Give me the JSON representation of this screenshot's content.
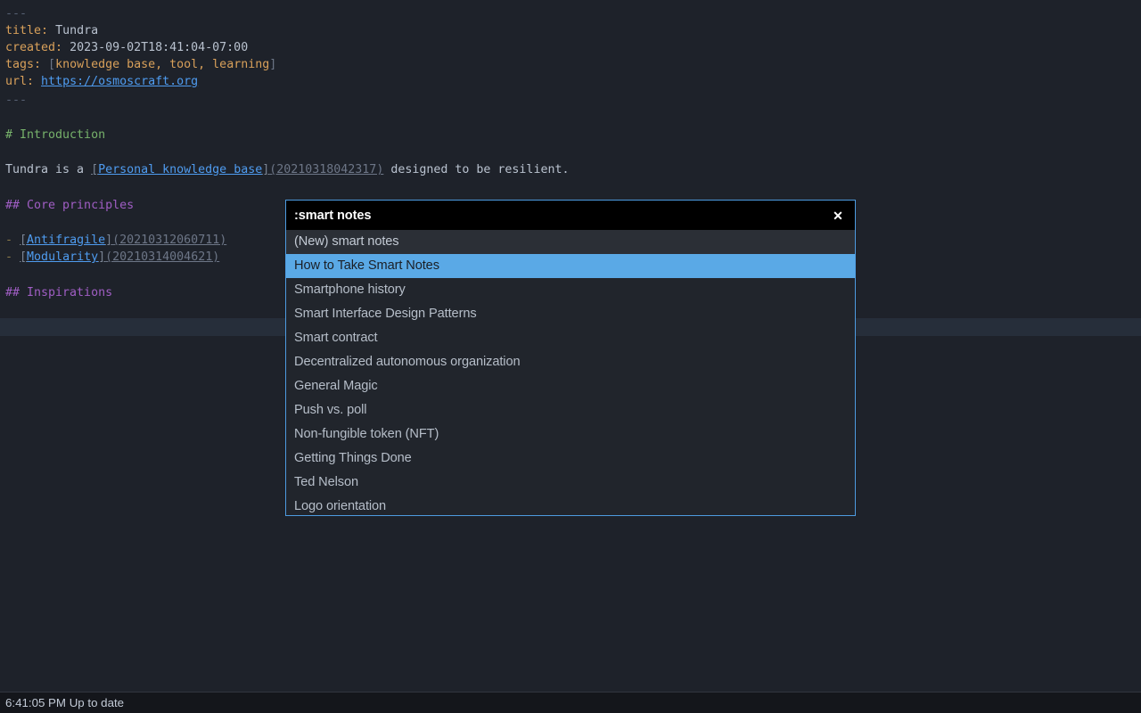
{
  "editor": {
    "frontmatter": {
      "open_delimiter": "---",
      "close_delimiter": "---",
      "title_key": "title:",
      "title_value": "Tundra",
      "created_key": "created:",
      "created_value": "2023-09-02T18:41:04-07:00",
      "tags_key": "tags:",
      "tags_open": "[",
      "tags_values": "knowledge base, tool, learning",
      "tags_close": "]",
      "url_key": "url:",
      "url_value": "https://osmoscraft.org"
    },
    "introduction": {
      "heading": "# Introduction",
      "body_prefix": "Tundra is a ",
      "body_link_open": "[",
      "body_link_text": "Personal knowledge base",
      "body_link_close": "]",
      "body_link_id": "(20210318042317)",
      "body_suffix": " designed to be resilient."
    },
    "core_principles": {
      "heading": "## Core principles",
      "items": [
        {
          "bullet": "-",
          "open": "[",
          "text": "Antifragile",
          "close": "]",
          "id": "(20210312060711)"
        },
        {
          "bullet": "-",
          "open": "[",
          "text": "Modularity",
          "close": "]",
          "id": "(20210314004621)"
        }
      ]
    },
    "inspirations": {
      "heading": "## Inspirations"
    }
  },
  "quick_open": {
    "query": ":smart notes",
    "placeholder": "",
    "close_label": "✕",
    "close_icon": "close-icon",
    "results": [
      {
        "label": "(New) smart notes",
        "state": "new"
      },
      {
        "label": "How to Take Smart Notes",
        "state": "selected"
      },
      {
        "label": "Smartphone history",
        "state": "normal"
      },
      {
        "label": "Smart Interface Design Patterns",
        "state": "normal"
      },
      {
        "label": "Smart contract",
        "state": "normal"
      },
      {
        "label": "Decentralized autonomous organization",
        "state": "normal"
      },
      {
        "label": "General Magic",
        "state": "normal"
      },
      {
        "label": "Push vs. poll",
        "state": "normal"
      },
      {
        "label": "Non-fungible token (NFT)",
        "state": "normal"
      },
      {
        "label": "Getting Things Done",
        "state": "normal"
      },
      {
        "label": "Ted Nelson",
        "state": "normal"
      },
      {
        "label": "Logo orientation",
        "state": "normal"
      }
    ]
  },
  "status_bar": {
    "time": "6:41:05 PM",
    "sync_status": "Up to date",
    "text": "6:41:05 PM Up to date"
  },
  "colors": {
    "editor_background": "#1e222a",
    "selection_blue": "#5aa9e6",
    "dialog_border": "#4d9be0",
    "link_blue": "#4f9cf0",
    "heading_h1_green": "#77b26b",
    "heading_h2_purple": "#a05ec4",
    "key_orange": "#d8a05a",
    "current_line": "#262e3a"
  }
}
